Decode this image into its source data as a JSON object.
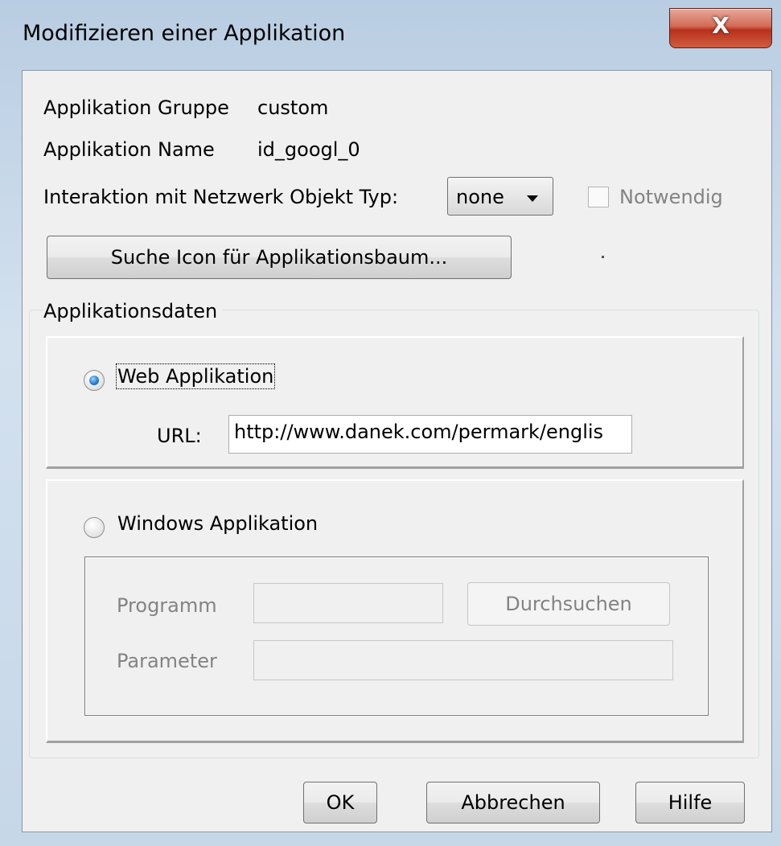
{
  "window": {
    "title": "Modifizieren einer Applikation",
    "close_label": "X"
  },
  "info": {
    "group_label": "Applikation Gruppe",
    "group_value": "custom",
    "name_label": "Applikation Name",
    "name_value": "id_googl_0",
    "interaction_label": "Interaktion mit Netzwerk Objekt Typ:",
    "interaction_value": "none",
    "required_label": "Notwendig",
    "required_checked": false,
    "icon_button_label": "Suche Icon für Applikationsbaum..."
  },
  "appdata": {
    "legend": "Applikationsdaten",
    "web": {
      "label": "Web Applikation",
      "selected": true,
      "url_label": "URL:",
      "url_value": "http://www.danek.com/permark/englis"
    },
    "windows": {
      "label": "Windows Applikation",
      "selected": false,
      "program_label": "Programm",
      "program_value": "",
      "browse_label": "Durchsuchen",
      "parameter_label": "Parameter",
      "parameter_value": ""
    }
  },
  "footer": {
    "ok_label": "OK",
    "cancel_label": "Abbrechen",
    "help_label": "Hilfe"
  },
  "colors": {
    "accent": "#2a7fd0",
    "close": "#c7432c",
    "disabled_text": "#838383"
  }
}
